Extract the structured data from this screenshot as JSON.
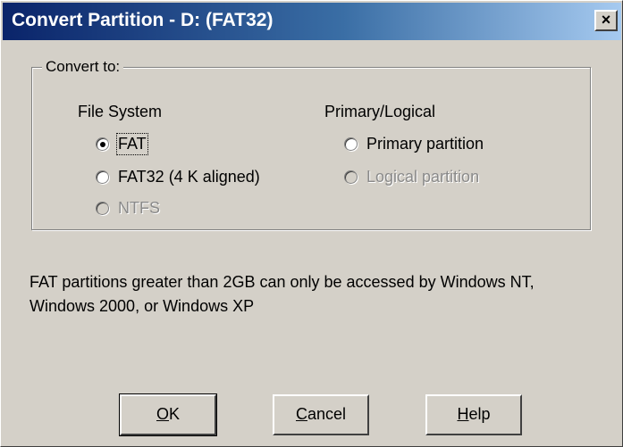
{
  "window": {
    "title": "Convert Partition - D:  (FAT32)",
    "close_glyph": "×"
  },
  "group": {
    "legend": "Convert to:"
  },
  "file_system": {
    "title": "File System",
    "options": [
      {
        "label": "FAT",
        "checked": true,
        "enabled": true
      },
      {
        "label": "FAT32 (4 K aligned)",
        "checked": false,
        "enabled": true
      },
      {
        "label": "NTFS",
        "checked": false,
        "enabled": false
      }
    ]
  },
  "partition_type": {
    "title": "Primary/Logical",
    "options": [
      {
        "label": "Primary partition",
        "checked": false,
        "enabled": true
      },
      {
        "label": "Logical partition",
        "checked": false,
        "enabled": false
      }
    ]
  },
  "info_text": "FAT partitions greater than 2GB can only be accessed by Windows NT, Windows 2000, or Windows XP",
  "buttons": {
    "ok": {
      "accel": "O",
      "rest": "K"
    },
    "cancel": {
      "accel": "C",
      "rest": "ancel"
    },
    "help": {
      "accel": "H",
      "rest": "elp"
    }
  },
  "colors": {
    "title_start": "#0a246a",
    "title_end": "#a6caf0",
    "face": "#d4d0c8"
  }
}
